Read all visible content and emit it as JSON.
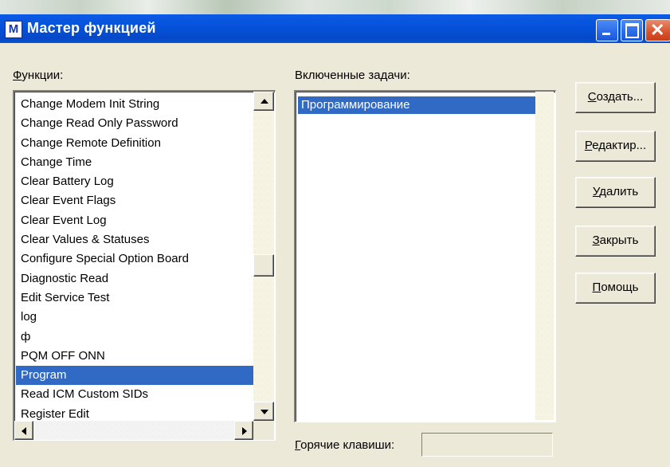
{
  "window": {
    "title": "Мастер функцией",
    "app_icon_letter": "M",
    "controls": {
      "close_glyph": "✕"
    }
  },
  "functions_label": {
    "hotkey": "Ф",
    "rest": "ункции:"
  },
  "functions": {
    "items": [
      "Change Modem Init String",
      "Change Read Only Password",
      "Change Remote Definition",
      "Change Time",
      "Clear Battery Log",
      "Clear Event Flags",
      "Clear Event Log",
      "Clear Values & Statuses",
      "Configure Special Option Board",
      "Diagnostic Read",
      "Edit Service Test",
      "log",
      "ф",
      "PQM OFF ONN",
      "Program",
      "Read ICM Custom SIDs",
      "Register Edit"
    ],
    "selected": "Program"
  },
  "tasks_label": "Включенные задачи:",
  "tasks": {
    "items": [
      "Программирование"
    ],
    "selected": "Программирование"
  },
  "hotkeys_label": {
    "hotkey": "Г",
    "rest": "орячие клавиши:"
  },
  "hotkeys_value": "",
  "buttons": {
    "create": {
      "hotkey": "С",
      "rest": "оздать..."
    },
    "edit": {
      "hotkey": "Р",
      "rest": "едактир..."
    },
    "delete": {
      "hotkey": "У",
      "rest": "далить"
    },
    "close": {
      "hotkey": "З",
      "rest": "акрыть"
    },
    "help": {
      "hotkey": "П",
      "rest": "омощь"
    }
  }
}
